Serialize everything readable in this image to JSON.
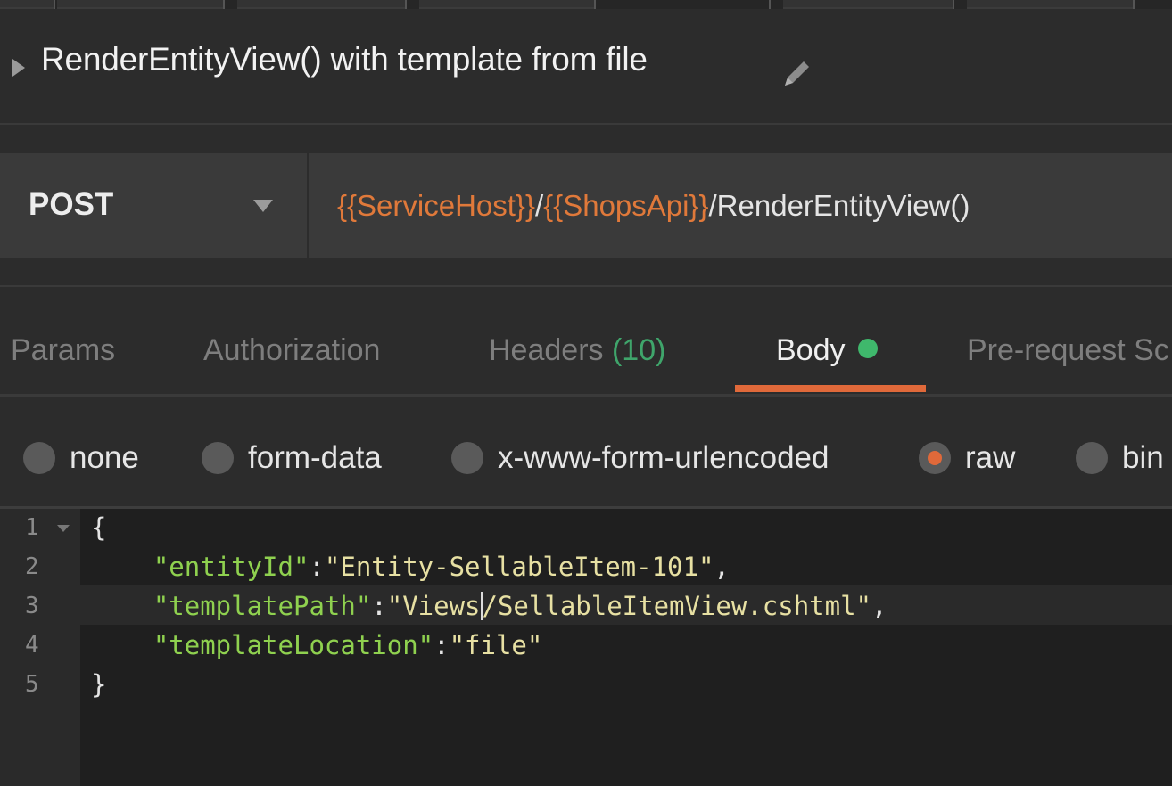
{
  "request": {
    "name": "RenderEntityView() with template from file",
    "method": "POST",
    "url_parts": [
      {
        "text": "{{ServiceHost}}",
        "kind": "var"
      },
      {
        "text": "/",
        "kind": "plain"
      },
      {
        "text": "{{ShopsApi}}",
        "kind": "var"
      },
      {
        "text": "/RenderEntityView()",
        "kind": "plain"
      }
    ]
  },
  "tabs": {
    "params": "Params",
    "authorization": "Authorization",
    "headers": "Headers",
    "headers_count": "(10)",
    "body": "Body",
    "prerequest": "Pre-request Sc"
  },
  "body_modes": {
    "none": "none",
    "form_data": "form-data",
    "urlencoded": "x-www-form-urlencoded",
    "raw": "raw",
    "binary": "bin",
    "selected": "raw"
  },
  "editor": {
    "line_numbers": [
      "1",
      "2",
      "3",
      "4",
      "5"
    ],
    "lines": {
      "open": "{",
      "k1": "\"entityId\"",
      "v1": "\"Entity-SellableItem-101\"",
      "k2": "\"templatePath\"",
      "v2a": "\"Views",
      "v2b": "/SellableItemView.cshtml\"",
      "k3": "\"templateLocation\"",
      "v3": "\"file\"",
      "close": "}"
    }
  },
  "colors": {
    "accent": "#e0693a",
    "variable": "#e0793a",
    "status_dot": "#3fb86c",
    "json_key": "#8fd14f",
    "json_string": "#e7e0a3"
  },
  "icons": [
    "edit-icon",
    "expand-caret-icon",
    "dropdown-caret-icon",
    "fold-icon"
  ]
}
